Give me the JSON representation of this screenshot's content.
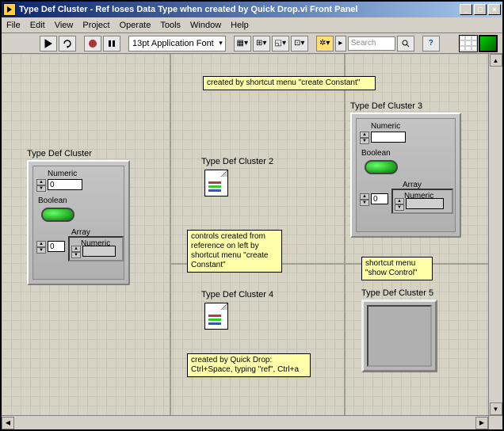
{
  "window": {
    "title": "Type Def Cluster - Ref loses Data Type when created by Quick Drop.vi Front Panel"
  },
  "menu": {
    "file": "File",
    "edit": "Edit",
    "view": "View",
    "project": "Project",
    "operate": "Operate",
    "tools": "Tools",
    "window": "Window",
    "help": "Help"
  },
  "toolbar": {
    "font": "13pt Application Font",
    "search_placeholder": "Search"
  },
  "labels": {
    "cluster1": "Type Def Cluster",
    "cluster2": "Type Def Cluster 2",
    "cluster3": "Type Def Cluster 3",
    "cluster4": "Type Def Cluster 4",
    "cluster5": "Type Def Cluster 5",
    "numeric": "Numeric",
    "boolean": "Boolean",
    "array": "Array"
  },
  "notes": {
    "top": "created by shortcut menu \"create Constant\"",
    "mid": "controls created from reference on left by shortcut menu \"create Constant\"",
    "right": "shortcut menu \"show Control\"",
    "bottom": "created by Quick Drop:\nCtrl+Space, typing \"ref\", Ctrl+a"
  },
  "values": {
    "numeric1": "0",
    "array1_idx": "0",
    "numeric3": "",
    "array3_idx": "0"
  }
}
